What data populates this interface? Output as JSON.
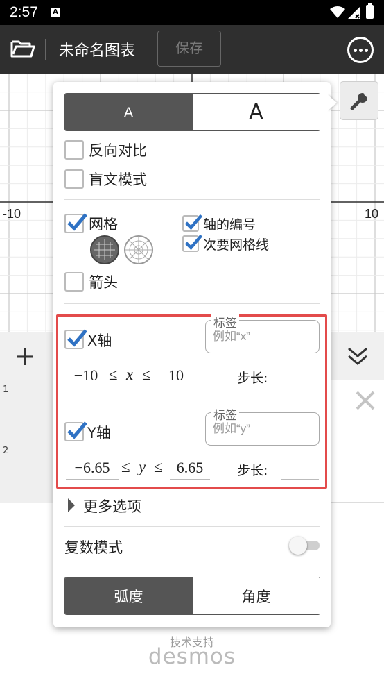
{
  "status_bar": {
    "time": "2:57",
    "notification_icon_label": "A"
  },
  "app_bar": {
    "title": "未命名图表",
    "save_label": "保存"
  },
  "graph": {
    "x_axis_min_label": "-10",
    "x_axis_max_label": "10"
  },
  "expressions": {
    "rows": [
      {
        "number": "1"
      },
      {
        "number": "2"
      }
    ]
  },
  "footer": {
    "powered_by": "技术支持",
    "brand": "desmos"
  },
  "settings": {
    "text_size": {
      "small": "A",
      "large": "A",
      "selected": "small"
    },
    "reverse_contrast": {
      "label": "反向对比",
      "checked": false
    },
    "braille_mode": {
      "label": "盲文模式",
      "checked": false
    },
    "grid": {
      "label": "网格",
      "checked": true,
      "grid_types": [
        "cartesian-grid",
        "polar-grid"
      ]
    },
    "axis_numbers": {
      "label": "轴的编号",
      "checked": true
    },
    "minor_gridlines": {
      "label": "次要网格线",
      "checked": true
    },
    "arrows": {
      "label": "箭头",
      "checked": false
    },
    "x_axis": {
      "label": "X轴",
      "checked": true,
      "label_field_caption": "标签",
      "label_placeholder": "例如“x”",
      "min": "−10",
      "var": "x",
      "max": "10",
      "leq": "≤",
      "step_label": "步长:"
    },
    "y_axis": {
      "label": "Y轴",
      "checked": true,
      "label_field_caption": "标签",
      "label_placeholder": "例如“y”",
      "min": "−6.65",
      "var": "y",
      "max": "6.65",
      "leq": "≤",
      "step_label": "步长:"
    },
    "more_options": "更多选项",
    "complex_mode": {
      "label": "复数模式",
      "enabled": false
    },
    "angle_units": {
      "radians": "弧度",
      "degrees": "角度",
      "selected": "radians"
    }
  },
  "colors": {
    "accent_check": "#2f72c4",
    "highlight_box": "#e34b4b",
    "app_bar": "#2f2f2f"
  }
}
